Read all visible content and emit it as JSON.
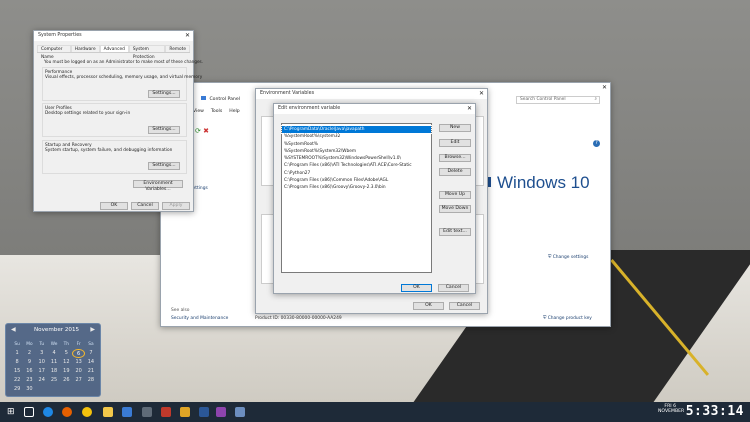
{
  "sysprops": {
    "title": "System Properties",
    "tabs": [
      "Computer Name",
      "Hardware",
      "Advanced",
      "System Protection",
      "Remote"
    ],
    "admin_note": "You must be logged on as an Administrator to make most of these changes.",
    "performance_title": "Performance",
    "performance_desc": "Visual effects, processor scheduling, memory usage, and virtual memory",
    "user_profiles_title": "User Profiles",
    "user_profiles_desc": "Desktop settings related to your sign-in",
    "startup_title": "Startup and Recovery",
    "startup_desc": "System startup, system failure, and debugging information",
    "settings_label": "Settings...",
    "env_vars_label": "Environment Variables...",
    "ok": "OK",
    "cancel": "Cancel",
    "apply": "Apply"
  },
  "control_panel": {
    "breadcrumb": "Control Panel",
    "search_placeholder": "Search Control Panel",
    "menu": [
      "View",
      "Tools",
      "Help"
    ],
    "sidebar": [
      "Manager",
      "settings",
      "otection",
      "system settings"
    ],
    "brand": "Windows 10",
    "change_settings": "Change settings",
    "change_product_key": "Change product key",
    "see_also": "See also",
    "security_link": "Security and Maintenance",
    "product_id": "Product ID: 00330-80000-00000-AA249"
  },
  "env_vars": {
    "title": "Environment Variables",
    "ok": "OK",
    "cancel": "Cancel"
  },
  "edit_env": {
    "title": "Edit environment variable",
    "entries": [
      "C:\\ProgramData\\Oracle\\Java\\javapath",
      "%SystemRoot%\\system32",
      "%SystemRoot%",
      "%SystemRoot%\\System32\\Wbem",
      "%SYSTEMROOT%\\System32\\WindowsPowerShell\\v1.0\\",
      "C:\\Program Files (x86)\\ATI Technologies\\ATI.ACE\\Core-Static",
      "C:\\Python27",
      "C:\\Program Files (x86)\\Common Files\\Adobe\\AGL",
      "C:\\Program Files (x86)\\Groovy\\Groovy-2.3.0\\bin"
    ],
    "buttons": [
      "New",
      "Edit",
      "Browse...",
      "Delete",
      "Move Up",
      "Move Down",
      "Edit text..."
    ],
    "ok": "OK",
    "cancel": "Cancel"
  },
  "calendar": {
    "month": "November 2015",
    "days": [
      "Su",
      "Mo",
      "Tu",
      "We",
      "Th",
      "Fr",
      "Sa"
    ],
    "weeks": [
      [
        "1",
        "2",
        "3",
        "4",
        "5",
        "6",
        "7"
      ],
      [
        "8",
        "9",
        "10",
        "11",
        "12",
        "13",
        "14"
      ],
      [
        "15",
        "16",
        "17",
        "18",
        "19",
        "20",
        "21"
      ],
      [
        "22",
        "23",
        "24",
        "25",
        "26",
        "27",
        "28"
      ],
      [
        "29",
        "30",
        "",
        "",
        "",
        "",
        ""
      ]
    ],
    "today": "6"
  },
  "clock": {
    "time": "5:33:14",
    "day": "FRI 6",
    "month": "NOVEMBER"
  },
  "colors": {
    "accent": "#0078d7",
    "taskbar": "#1e2a38",
    "brand_blue": "#1e4f8f"
  }
}
